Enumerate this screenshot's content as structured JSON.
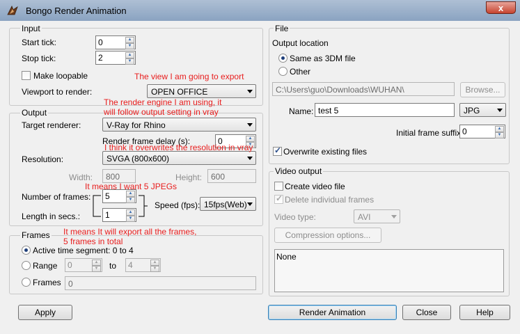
{
  "window": {
    "title": "Bongo Render Animation",
    "close_glyph": "x"
  },
  "input": {
    "legend": "Input",
    "start_tick_label": "Start tick:",
    "start_tick_value": "0",
    "stop_tick_label": "Stop tick:",
    "stop_tick_value": "2",
    "loopable_label": "Make loopable",
    "viewport_label": "Viewport to render:",
    "viewport_value": "OPEN OFFICE"
  },
  "output": {
    "legend": "Output",
    "target_renderer_label": "Target renderer:",
    "target_renderer_value": "V-Ray for Rhino",
    "frame_delay_label": "Render frame delay (s):",
    "frame_delay_value": "0",
    "resolution_label": "Resolution:",
    "resolution_value": "SVGA (800x600)",
    "width_label": "Width:",
    "width_value": "800",
    "height_label": "Height:",
    "height_value": "600",
    "num_frames_label": "Number of frames:",
    "num_frames_value": "5",
    "length_label": "Length in secs.:",
    "length_value": "1",
    "speed_label": "Speed (fps):",
    "speed_value": "15fps(Web)"
  },
  "frames": {
    "legend": "Frames",
    "active_label": "Active time segment: 0 to 4",
    "range_label": "Range",
    "range_from": "0",
    "range_to_label": "to",
    "range_to": "4",
    "frames_label": "Frames",
    "frames_value": "0"
  },
  "file": {
    "legend": "File",
    "output_location_label": "Output location",
    "same_as_label": "Same as 3DM file",
    "other_label": "Other",
    "path_value": "C:\\Users\\guo\\Downloads\\WUHAN\\",
    "browse_label": "Browse...",
    "name_label": "Name:",
    "name_value": "test 5",
    "format_value": "JPG",
    "suffix_label": "Initial frame suffix:",
    "suffix_value": "0",
    "overwrite_label": "Overwrite existing files"
  },
  "video": {
    "legend": "Video output",
    "create_label": "Create video file",
    "delete_label": "Delete individual frames",
    "type_label": "Video type:",
    "type_value": "AVI",
    "compression_label": "Compression options...",
    "list_value": "None"
  },
  "buttons": {
    "apply": "Apply",
    "render": "Render Animation",
    "close": "Close",
    "help": "Help"
  },
  "annotations": {
    "view": "The view I am going to export",
    "engine_line1": "The render engine I am using, it",
    "engine_line2": "will follow output setting in vray",
    "resolution": "I think it overwrites the resolution in vray",
    "jpegs": "It means I want 5 JPEGs",
    "frames_line1": "It means It will export all the frames,",
    "frames_line2": "5 frames in total"
  },
  "colors": {
    "annotation": "#e81c1c",
    "titlebar": "#9cb2cc",
    "close_button": "#c6442f"
  }
}
